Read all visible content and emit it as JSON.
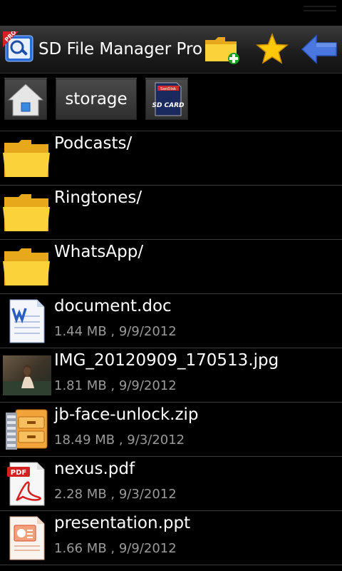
{
  "app": {
    "title": "SD File Manager Pro",
    "badge": "PRO"
  },
  "toolbar": {
    "new_folder_icon": "new-folder-icon",
    "favorites_icon": "star-icon",
    "back_icon": "back-arrow-icon"
  },
  "path": {
    "home_icon": "home-icon",
    "current_folder": "storage",
    "sd_card_icon": "sd-card-icon",
    "sd_card_label_top": "SanDisk",
    "sd_card_label": "SD CARD"
  },
  "files": [
    {
      "name": "Podcasts/",
      "meta": "",
      "icon": "folder-icon"
    },
    {
      "name": "Ringtones/",
      "meta": "",
      "icon": "folder-icon"
    },
    {
      "name": "WhatsApp/",
      "meta": "",
      "icon": "folder-icon"
    },
    {
      "name": "document.doc",
      "meta": "1.44 MB , 9/9/2012",
      "icon": "word-document-icon"
    },
    {
      "name": "IMG_20120909_170513.jpg",
      "meta": "1.81 MB , 9/9/2012",
      "icon": "image-thumbnail"
    },
    {
      "name": "jb-face-unlock.zip",
      "meta": "18.49 MB , 9/3/2012",
      "icon": "zip-archive-icon"
    },
    {
      "name": "nexus.pdf",
      "meta": "2.28 MB , 9/3/2012",
      "icon": "pdf-icon"
    },
    {
      "name": "presentation.ppt",
      "meta": "1.66 MB , 9/9/2012",
      "icon": "powerpoint-icon"
    }
  ],
  "pdf_label": "PDF",
  "colors": {
    "folder": "#f7c21c",
    "star": "#ffc80a",
    "back_arrow": "#4a78e0",
    "title_bar": "#1c1c1c"
  }
}
